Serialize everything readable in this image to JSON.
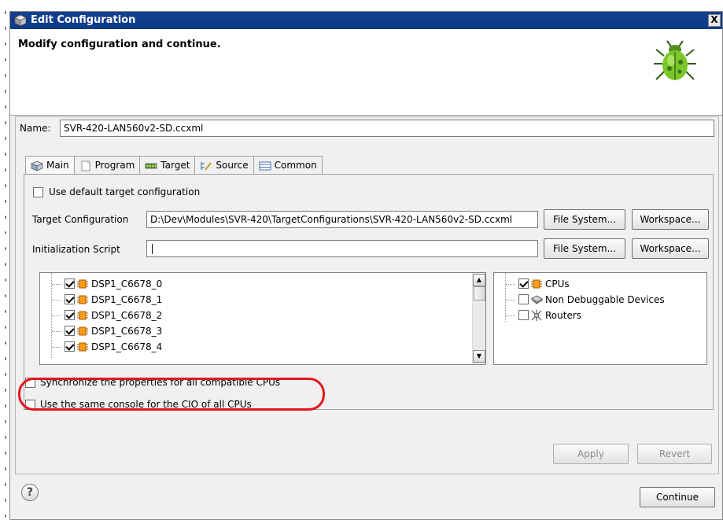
{
  "window": {
    "title": "Edit Configuration",
    "close_label": "X",
    "heading": "Modify configuration and continue."
  },
  "name_field": {
    "label": "Name:",
    "value": "SVR-420-LAN560v2-SD.ccxml"
  },
  "tabs": [
    {
      "label": "Main",
      "icon": "main-icon",
      "active": true
    },
    {
      "label": "Program",
      "icon": "program-icon",
      "active": false
    },
    {
      "label": "Target",
      "icon": "target-icon",
      "active": false
    },
    {
      "label": "Source",
      "icon": "source-icon",
      "active": false
    },
    {
      "label": "Common",
      "icon": "common-icon",
      "active": false
    }
  ],
  "main": {
    "use_default_label": "Use default target configuration",
    "target_config": {
      "label": "Target Configuration",
      "value": "D:\\Dev\\Modules\\SVR-420\\TargetConfigurations\\SVR-420-LAN560v2-SD.ccxml",
      "file_system_label": "File System...",
      "workspace_label": "Workspace..."
    },
    "init_script": {
      "label": "Initialization Script",
      "value": "",
      "file_system_label": "File System...",
      "workspace_label": "Workspace..."
    },
    "cpu_list": [
      {
        "label": "DSP1_C6678_0",
        "checked": true
      },
      {
        "label": "DSP1_C6678_1",
        "checked": true
      },
      {
        "label": "DSP1_C6678_2",
        "checked": true
      },
      {
        "label": "DSP1_C6678_3",
        "checked": true
      },
      {
        "label": "DSP1_C6678_4",
        "checked": true
      }
    ],
    "filter_list": [
      {
        "label": "CPUs",
        "checked": true,
        "icon": "cpu-chip-icon"
      },
      {
        "label": "Non Debuggable Devices",
        "checked": false,
        "icon": "device-icon"
      },
      {
        "label": "Routers",
        "checked": false,
        "icon": "router-icon"
      }
    ],
    "sync_label": "Synchronize the properties for all compatible CPUs",
    "same_console_label": "Use the same console for the CIO of all CPUs"
  },
  "actions": {
    "apply_label": "Apply",
    "revert_label": "Revert",
    "continue_label": "Continue",
    "help_label": "?"
  },
  "colors": {
    "titlebar": "#14408f",
    "highlight_annotation": "#e3161e"
  }
}
